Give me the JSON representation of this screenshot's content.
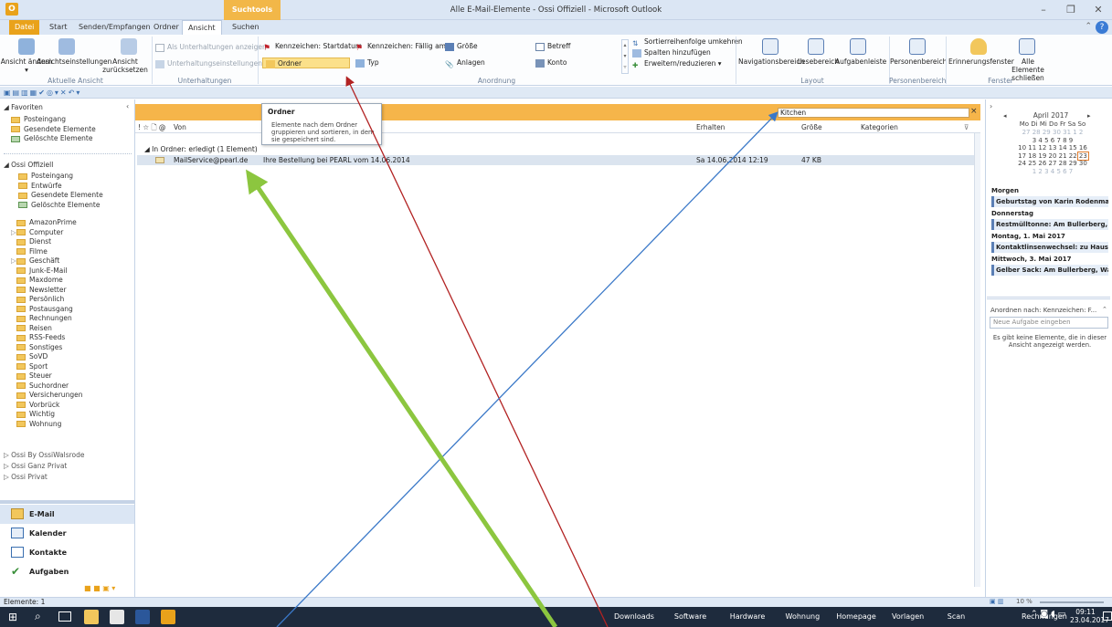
{
  "window": {
    "title": "Alle E-Mail-Elemente - Ossi Offiziell - Microsoft Outlook",
    "contextual_tab": "Suchtools",
    "app_letter": "O"
  },
  "tabs": [
    {
      "label": "Datei"
    },
    {
      "label": "Start"
    },
    {
      "label": "Senden/Empfangen"
    },
    {
      "label": "Ordner"
    },
    {
      "label": "Ansicht"
    },
    {
      "label": "Suchen"
    }
  ],
  "ribbon": {
    "aktuelle_ansicht": {
      "label": "Aktuelle Ansicht",
      "change": "Ansicht ändern ▾",
      "settings": "Ansichtseinstellungen",
      "reset": "Ansicht zurücksetzen"
    },
    "unterhaltungen": {
      "label": "Unterhaltungen",
      "show": "Als Unterhaltungen anzeigen",
      "settings": "Unterhaltungseinstellungen ▾"
    },
    "anordnung": {
      "label": "Anordnung",
      "start": "Kennzeichen: Startdatum",
      "due": "Kennzeichen: Fällig am",
      "size": "Größe",
      "subject": "Betreff",
      "folder": "Ordner",
      "type": "Typ",
      "attachments": "Anlagen",
      "account": "Konto",
      "reverse": "Sortierreihenfolge umkehren",
      "add_cols": "Spalten hinzufügen",
      "expand": "Erweitern/reduzieren ▾"
    },
    "layout": {
      "label": "Layout",
      "nav": "Navigationsbereich",
      "reading": "Lesebereich",
      "todo": "Aufgabenleiste"
    },
    "personenbereich": {
      "label": "Personenbereich",
      "btn": "Personenbereich"
    },
    "fenster": {
      "label": "Fenster",
      "reminders": "Erinnerungsfenster",
      "close_all": "Alle Elemente schließen"
    }
  },
  "nav": {
    "favorites_header": "◢ Favoriten",
    "favorites": [
      "Posteingang",
      "Gesendete Elemente",
      "Gelöschte Elemente"
    ],
    "account_header": "◢ Ossi Offiziell",
    "account_folders": [
      "Posteingang",
      "Entwürfe",
      "Gesendete Elemente",
      "Gelöschte Elemente"
    ],
    "folders": [
      "AmazonPrime",
      "Computer",
      "Dienst",
      "Filme",
      "Geschäft",
      "Junk-E-Mail",
      "Maxdome",
      "Newsletter",
      "Persönlich",
      "Postausgang",
      "Rechnungen",
      "Reisen",
      "RSS-Feeds",
      "Sonstiges",
      "SoVD",
      "Sport",
      "Steuer",
      "Suchordner",
      "Versicherungen",
      "Vorbrück",
      "Wichtig",
      "Wohnung"
    ],
    "other_accounts": [
      "Ossi By OssiWalsrode",
      "Ossi Ganz Privat",
      "Ossi Privat"
    ],
    "modules": [
      "E-Mail",
      "Kalender",
      "Kontakte",
      "Aufgaben"
    ]
  },
  "list": {
    "columns": {
      "icons": "! ☆ 🗋 @",
      "from": "Von",
      "received": "Erhalten",
      "size": "Größe",
      "categories": "Kategorien"
    },
    "group": "◢  In Ordner: erledigt (1 Element)",
    "rows": [
      {
        "from": "MailService@pearl.de",
        "subject": "Ihre Bestellung bei PEARL vom 14.06.2014",
        "received": "Sa 14.06.2014 12:19",
        "size": "47 KB"
      }
    ]
  },
  "tooltip": {
    "title": "Ordner",
    "text": "Elemente nach dem Ordner gruppieren und sortieren, in dem sie gespeichert sind."
  },
  "search": {
    "value": "Kitchen",
    "clear": "×"
  },
  "calendar": {
    "month": "April 2017",
    "prev": "◂",
    "next": "▸",
    "weekdays": "Mo Di Mi Do Fr Sa So",
    "weeks": [
      "27 28 29 30 31  1  2",
      "3  4  5  6  7  8  9",
      "10 11 12 13 14 15 16",
      "17 18 19 20 21 22 23",
      "24 25 26 27 28 29 30",
      "1  2  3  4  5  6  7"
    ],
    "today": "23"
  },
  "todo": {
    "days": [
      {
        "label": "Morgen",
        "item": "Geburtstag von Karin Rodenman"
      },
      {
        "label": "Donnerstag",
        "item": "Restmülltonne: Am Bullerberg, Wals"
      },
      {
        "label": "Montag, 1. Mai 2017",
        "item": "Kontaktlinsenwechsel: zu Haus"
      },
      {
        "label": "Mittwoch, 3. Mai 2017",
        "item": "Gelber Sack: Am Bullerberg, Walsroc"
      }
    ],
    "arrange": "Anordnen nach: Kennzeichen: F...",
    "new_task": "Neue Aufgabe eingeben",
    "empty": "Es gibt keine Elemente, die in dieser Ansicht angezeigt werden."
  },
  "status": {
    "text": "Elemente: 1",
    "zoom": "10 %"
  },
  "taskbar": {
    "links": [
      "Downloads",
      "Software",
      "Hardware",
      "Wohnung",
      "Homepage",
      "Vorlagen",
      "Scan Pension",
      "Rechnungen"
    ],
    "time": "09:11",
    "date": "23.04.2017"
  },
  "colors": {
    "accent": "#f6b54a",
    "ribbon_bg": "#dbe6f4",
    "taskbar": "#1e2b3d",
    "arrow_green": "#8cc63f",
    "arrow_red": "#b22222",
    "arrow_blue": "#3a78c8"
  }
}
